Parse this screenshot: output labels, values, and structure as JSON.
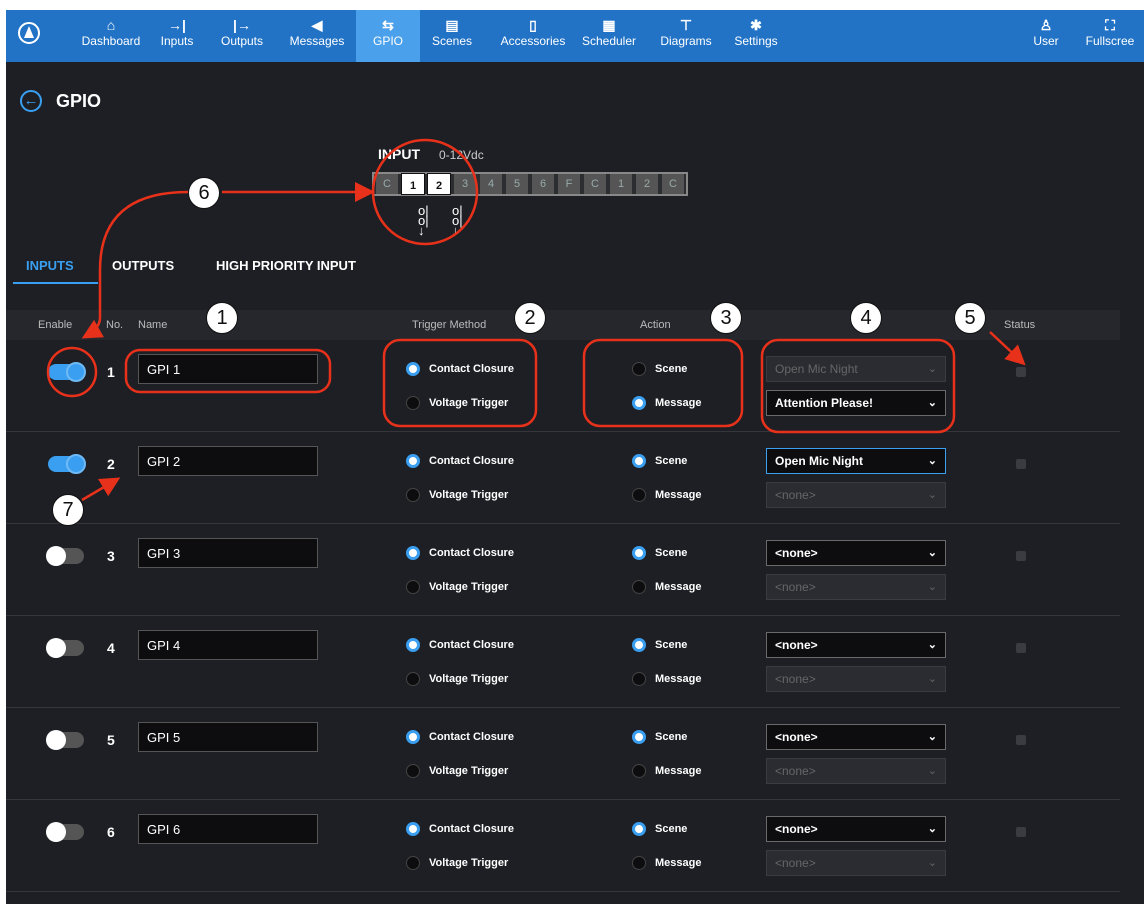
{
  "nav": {
    "items": [
      {
        "label": "Dashboard",
        "icon": "dashboard-icon",
        "glyph": "⌂"
      },
      {
        "label": "Inputs",
        "icon": "inputs-icon",
        "glyph": "→|"
      },
      {
        "label": "Outputs",
        "icon": "outputs-icon",
        "glyph": "|→"
      },
      {
        "label": "Messages",
        "icon": "messages-icon",
        "glyph": "◀"
      },
      {
        "label": "GPIO",
        "icon": "gpio-icon",
        "glyph": "⇆"
      },
      {
        "label": "Scenes",
        "icon": "scenes-icon",
        "glyph": "▤"
      },
      {
        "label": "Accessories",
        "icon": "accessories-icon",
        "glyph": "▯"
      },
      {
        "label": "Scheduler",
        "icon": "scheduler-icon",
        "glyph": "▦"
      },
      {
        "label": "Diagrams",
        "icon": "diagrams-icon",
        "glyph": "⊤"
      },
      {
        "label": "Settings",
        "icon": "settings-icon",
        "glyph": "✱"
      }
    ],
    "user_label": "User",
    "fullscreen_label": "Fullscree",
    "active": "GPIO"
  },
  "page": {
    "title": "GPIO"
  },
  "connector": {
    "label": "INPUT",
    "range": "0-12Vdc",
    "pins": [
      "C",
      "1",
      "2",
      "3",
      "4",
      "5",
      "6",
      "F",
      "C",
      "1",
      "2",
      "C"
    ]
  },
  "tabs": [
    "INPUTS",
    "OUTPUTS",
    "HIGH PRIORITY INPUT"
  ],
  "table": {
    "headers": {
      "enable": "Enable",
      "no": "No.",
      "name": "Name",
      "trigger": "Trigger Method",
      "action": "Action",
      "status": "Status"
    },
    "trigger_options": [
      "Contact Closure",
      "Voltage Trigger"
    ],
    "action_options": [
      "Scene",
      "Message"
    ],
    "rows": [
      {
        "no": "1",
        "name": "GPI 1",
        "enabled": true,
        "trigger": "Contact Closure",
        "action": "Message",
        "scene": "Open Mic Night",
        "message": "Attention Please!"
      },
      {
        "no": "2",
        "name": "GPI 2",
        "enabled": true,
        "trigger": "Contact Closure",
        "action": "Scene",
        "scene": "Open Mic Night",
        "message": "<none>"
      },
      {
        "no": "3",
        "name": "GPI 3",
        "enabled": false,
        "trigger": "Contact Closure",
        "action": "Scene",
        "scene": "<none>",
        "message": "<none>"
      },
      {
        "no": "4",
        "name": "GPI 4",
        "enabled": false,
        "trigger": "Contact Closure",
        "action": "Scene",
        "scene": "<none>",
        "message": "<none>"
      },
      {
        "no": "5",
        "name": "GPI 5",
        "enabled": false,
        "trigger": "Contact Closure",
        "action": "Scene",
        "scene": "<none>",
        "message": "<none>"
      },
      {
        "no": "6",
        "name": "GPI 6",
        "enabled": false,
        "trigger": "Contact Closure",
        "action": "Scene",
        "scene": "<none>",
        "message": "<none>"
      }
    ]
  },
  "callouts": [
    "1",
    "2",
    "3",
    "4",
    "5",
    "6",
    "7"
  ],
  "colors": {
    "nav_bg": "#2273c6",
    "accent": "#3a9ff0",
    "annotation": "#e8311a",
    "panel_bg": "#1d1f24"
  }
}
